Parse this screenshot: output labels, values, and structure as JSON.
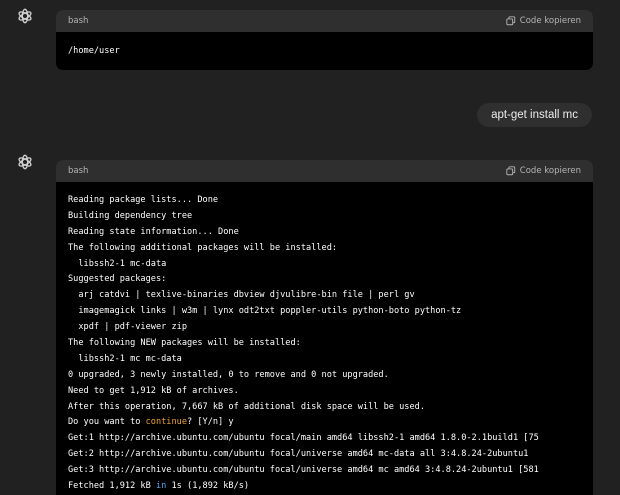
{
  "messages": [
    {
      "role": "assistant",
      "code": {
        "language": "bash",
        "copy_label": "Code kopieren",
        "lines": [
          [
            {
              "t": "/home/user"
            }
          ]
        ]
      }
    },
    {
      "role": "user",
      "text": "apt-get install mc"
    },
    {
      "role": "assistant",
      "code": {
        "language": "bash",
        "copy_label": "Code kopieren",
        "lines": [
          [
            {
              "t": "Reading package lists... Done"
            }
          ],
          [
            {
              "t": "Building dependency tree"
            }
          ],
          [
            {
              "t": "Reading state information... Done"
            }
          ],
          [
            {
              "t": "The following additional packages will be installed:"
            }
          ],
          [
            {
              "t": "  libssh2-1 mc-data"
            }
          ],
          [
            {
              "t": "Suggested packages:"
            }
          ],
          [
            {
              "t": "  arj catdvi | texlive-binaries dbview djvulibre-bin file | perl gv"
            }
          ],
          [
            {
              "t": "  imagemagick links | w3m | lynx odt2txt poppler-utils python-boto python-tz"
            }
          ],
          [
            {
              "t": "  xpdf | pdf-viewer zip"
            }
          ],
          [
            {
              "t": "The following NEW packages will be installed:"
            }
          ],
          [
            {
              "t": "  libssh2-1 mc mc-data"
            }
          ],
          [
            {
              "t": "0 upgraded, 3 newly installed, 0 to remove and 0 not upgraded."
            }
          ],
          [
            {
              "t": "Need to get 1,912 kB of archives."
            }
          ],
          [
            {
              "t": "After this operation, 7,667 kB of additional disk space will be used."
            }
          ],
          [
            {
              "t": "Do you want to "
            },
            {
              "t": "continue",
              "c": "orange"
            },
            {
              "t": "? [Y/n] y"
            }
          ],
          [
            {
              "t": "Get:1 http://archive.ubuntu.com/ubuntu focal/main amd64 libssh2-1 amd64 1.8.0-2.1build1 [75"
            }
          ],
          [
            {
              "t": "Get:2 http://archive.ubuntu.com/ubuntu focal/universe amd64 mc-data all 3:4.8.24-2ubuntu1"
            }
          ],
          [
            {
              "t": "Get:3 http://archive.ubuntu.com/ubuntu focal/universe amd64 mc amd64 3:4.8.24-2ubuntu1 [581"
            }
          ],
          [
            {
              "t": "Fetched 1,912 kB "
            },
            {
              "t": "in",
              "c": "blue"
            },
            {
              "t": " 1s (1,892 kB/s)"
            }
          ]
        ]
      }
    }
  ],
  "icons": {
    "assistant_avatar": "openai-logo-icon",
    "copy": "copy-icon"
  },
  "colors": {
    "background": "#212121",
    "code_header": "#2f2f2f",
    "code_body": "#000000",
    "user_bubble": "#2f2f2f",
    "keyword_orange": "#e6a23c",
    "keyword_blue": "#5aa6e8"
  }
}
